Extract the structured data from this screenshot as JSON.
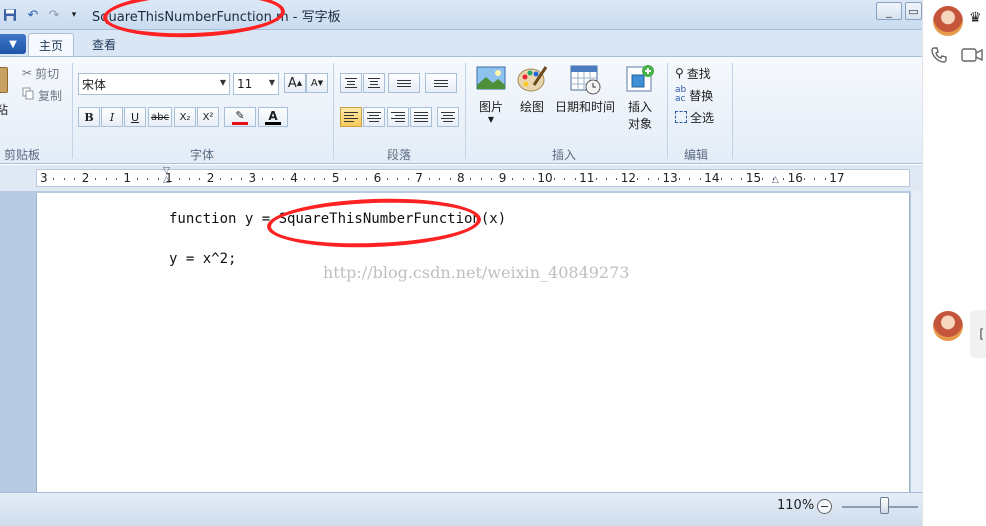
{
  "window": {
    "title": "SquareThisNumberFunction.m - 写字板",
    "minimize": "_",
    "restore": "▭"
  },
  "ribbon": {
    "tabs": [
      {
        "label": "主页",
        "active": true
      },
      {
        "label": "查看",
        "active": false
      }
    ],
    "clipboard": {
      "paste_label": "粘",
      "cut_label": "剪切",
      "copy_label": "复制",
      "group_label": "剪贴板"
    },
    "font": {
      "font_name": "宋体",
      "font_size": "11",
      "grow_label": "A",
      "shrink_label": "A",
      "bold": "B",
      "italic": "I",
      "underline": "U",
      "strike": "abc",
      "subscript": "X₂",
      "superscript": "X²",
      "highlight_label": "✎",
      "color_label": "A",
      "group_label": "字体",
      "highlight_color": "#e01010",
      "text_color": "#000000"
    },
    "paragraph": {
      "group_label": "段落"
    },
    "insert": {
      "picture_label": "图片",
      "paint_label": "绘图",
      "datetime_label": "日期和时间",
      "object_label_1": "插入",
      "object_label_2": "对象",
      "group_label": "插入"
    },
    "editing": {
      "find_label": "查找",
      "replace_label": "替换",
      "select_all_label": "全选",
      "group_label": "编辑"
    }
  },
  "ruler": {
    "numbers": [
      "3",
      "2",
      "1",
      "1",
      "2",
      "3",
      "4",
      "5",
      "6",
      "7",
      "8",
      "9",
      "10",
      "11",
      "12",
      "13",
      "14",
      "15",
      "16",
      "17"
    ]
  },
  "document": {
    "lines": [
      "function y = SquareThisNumberFunction(x)",
      "y = x^2;"
    ],
    "watermark": "http://blog.csdn.net/weixin_40849273"
  },
  "status": {
    "zoom": "110%",
    "zoom_minus": "−"
  },
  "chat": {
    "bubble_text": "[",
    "crown": "♛"
  },
  "colors": {
    "annotation": "#ff2222",
    "ribbon_accent": "#1f55a8"
  }
}
